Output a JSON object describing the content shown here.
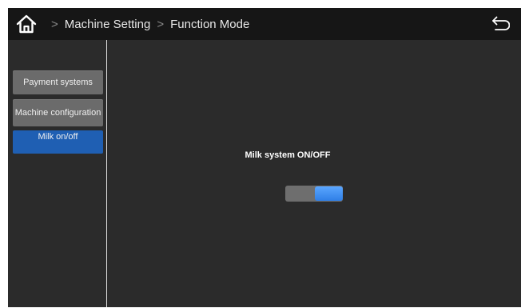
{
  "topbar": {
    "breadcrumb": [
      "Machine Setting",
      "Function Mode"
    ],
    "separator": ">"
  },
  "sidebar": {
    "items": [
      {
        "label": "Payment systems",
        "active": false
      },
      {
        "label": "Machine configuration",
        "active": false
      },
      {
        "label": "Milk on/off",
        "active": true
      }
    ]
  },
  "main": {
    "title": "Milk system ON/OFF",
    "toggle_on": true
  },
  "colors": {
    "screen_bg": "#2b2b2b",
    "topbar_bg": "#161616",
    "active_tab": "#1f5fb3",
    "toggle_on": "#3a8cf2"
  },
  "icons": {
    "home": "home-icon",
    "back": "back-arrow-icon"
  }
}
